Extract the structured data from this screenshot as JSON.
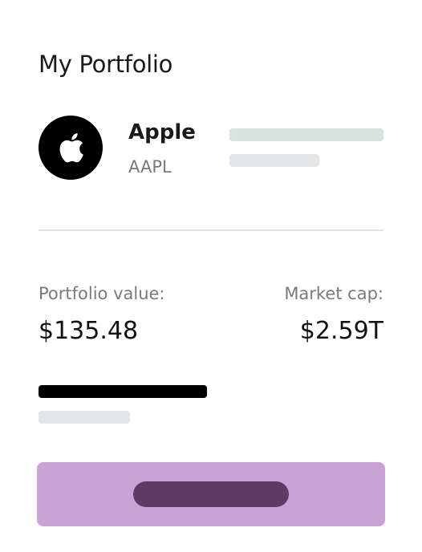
{
  "header": {
    "title": "My Portfolio"
  },
  "stock": {
    "name": "Apple",
    "ticker": "AAPL",
    "logo_icon": "apple-logo-icon"
  },
  "stats": {
    "portfolio_value_label": "Portfolio value:",
    "portfolio_value": "$135.48",
    "market_cap_label": "Market cap:",
    "market_cap": "$2.59T"
  },
  "colors": {
    "button_background": "#c9a2d6",
    "button_placeholder": "#613a68",
    "price_skeleton": "#d6e3de",
    "skeleton_grey": "#e3e5e7"
  }
}
